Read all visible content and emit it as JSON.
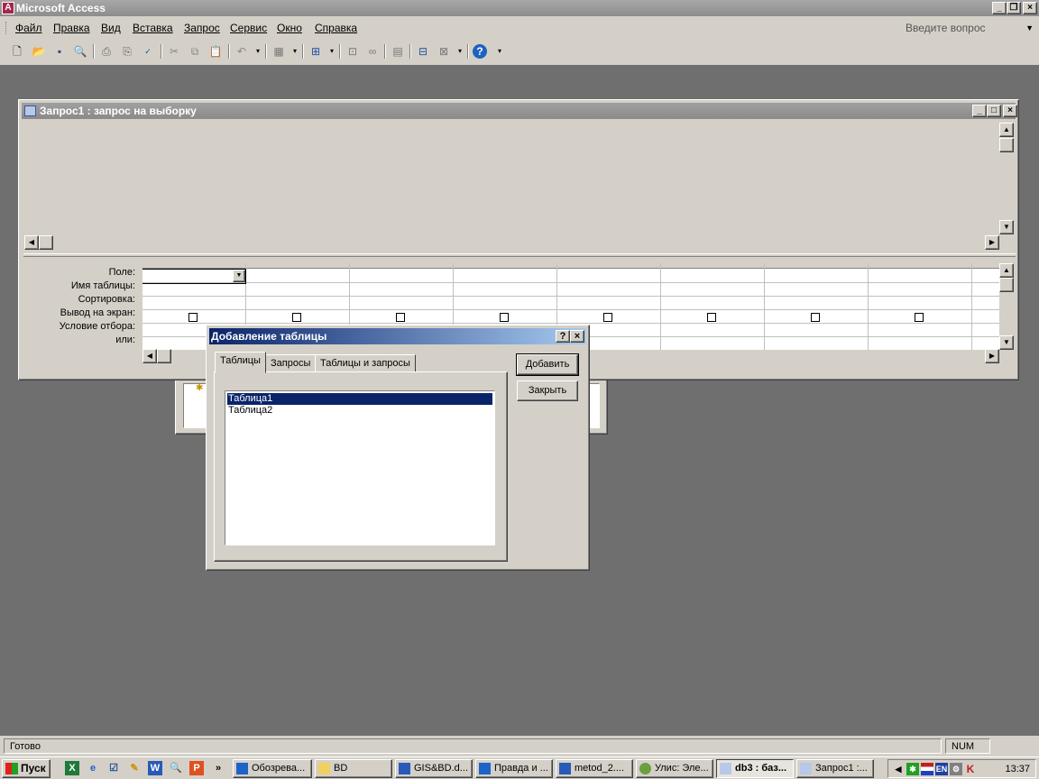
{
  "app": {
    "title": "Microsoft Access"
  },
  "menu": {
    "items": [
      "Файл",
      "Правка",
      "Вид",
      "Вставка",
      "Запрос",
      "Сервис",
      "Окно",
      "Справка"
    ],
    "help_placeholder": "Введите вопрос"
  },
  "toolbar": {
    "icons": [
      "new-icon",
      "open-icon",
      "save-icon",
      "search-icon",
      "print-icon",
      "print-preview-icon",
      "spelling-icon",
      "cut-icon",
      "copy-icon",
      "paste-icon",
      "undo-icon",
      "query-type-icon",
      "run-icon",
      "show-table-icon",
      "totals-icon",
      "properties-icon",
      "build-icon",
      "database-window-icon",
      "new-object-icon",
      "help-icon"
    ]
  },
  "query_window": {
    "title": "Запрос1 : запрос на выборку",
    "grid_labels": [
      "Поле:",
      "Имя таблицы:",
      "Сортировка:",
      "Вывод на экран:",
      "Условие отбора:",
      "или:"
    ]
  },
  "dialog": {
    "title": "Добавление таблицы",
    "help_btn": "?",
    "close_btn": "×",
    "tabs": [
      "Таблицы",
      "Запросы",
      "Таблицы и запросы"
    ],
    "items": [
      "Таблица1",
      "Таблица2"
    ],
    "add_button": "Добавить",
    "close_button": "Закрыть"
  },
  "status": {
    "text": "Готово",
    "num": "NUM"
  },
  "taskbar": {
    "start": "Пуск",
    "quicklaunch_more": "»",
    "tasks": [
      "Обозрева...",
      "BD",
      "GIS&BD.d...",
      "Правда и ...",
      "metod_2....",
      "Улис: Эле...",
      "db3 : баз...",
      "Запрос1 :..."
    ],
    "tray_lang": "EN",
    "clock": "13:37"
  }
}
